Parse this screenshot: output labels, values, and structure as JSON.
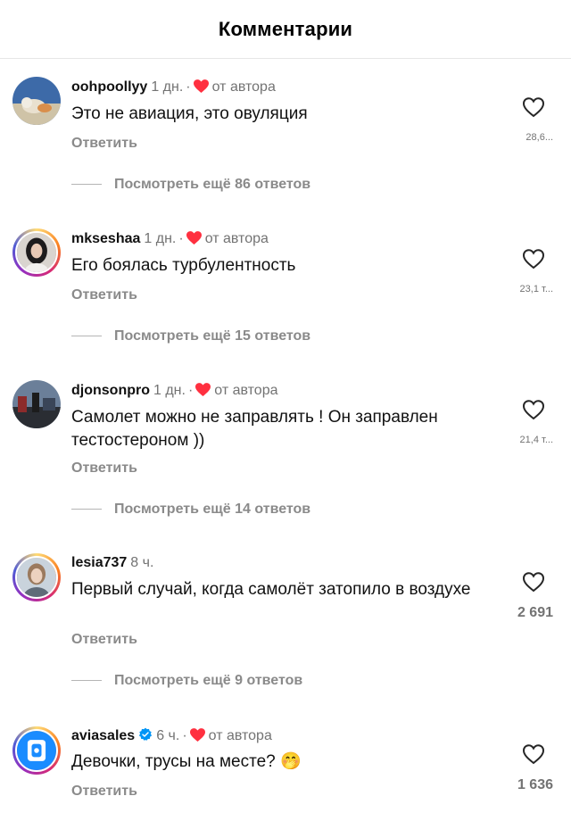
{
  "header": {
    "title": "Комментарии"
  },
  "comments": [
    {
      "username": "oohpoollyy",
      "time": "1 дн.",
      "dot": "·",
      "by_author": "от автора",
      "text": "Это не авиация, это овуляция",
      "reply": "Ответить",
      "likes": "28,6...",
      "more_replies": "Посмотреть ещё 86 ответов",
      "avatar_icon": "cat-photo-avatar"
    },
    {
      "username": "mkseshaa",
      "time": "1 дн.",
      "dot": "·",
      "by_author": "от автора",
      "text": "Его боялась турбулентность",
      "reply": "Ответить",
      "likes": "23,1 т...",
      "more_replies": "Посмотреть ещё 15 ответов",
      "avatar_icon": "portrait-avatar"
    },
    {
      "username": "djonsonpro",
      "time": "1 дн.",
      "dot": "·",
      "by_author": "от автора",
      "text": "Самолет можно не заправлять ! Он заправлен тестостероном ))",
      "reply": "Ответить",
      "likes": "21,4 т...",
      "more_replies": "Посмотреть ещё 14 ответов",
      "avatar_icon": "scene-avatar"
    },
    {
      "username": "lesia737",
      "time": "8 ч.",
      "text": "Первый  случай, когда самолёт затопило в воздухе",
      "reply": "Ответить",
      "likes": "2 691",
      "more_replies": "Посмотреть ещё 9 ответов",
      "avatar_icon": "portrait-avatar"
    },
    {
      "username": "aviasales",
      "time": "6 ч.",
      "dot": "·",
      "by_author": "от автора",
      "text": "Девочки, трусы на месте?",
      "emoji": "🤭",
      "reply": "Ответить",
      "likes": "1 636",
      "avatar_icon": "aviasales-logo"
    }
  ],
  "colors": {
    "author_heart": "#ff3040",
    "verified": "#0095f6",
    "aviasales_blue": "#1a8cff"
  }
}
